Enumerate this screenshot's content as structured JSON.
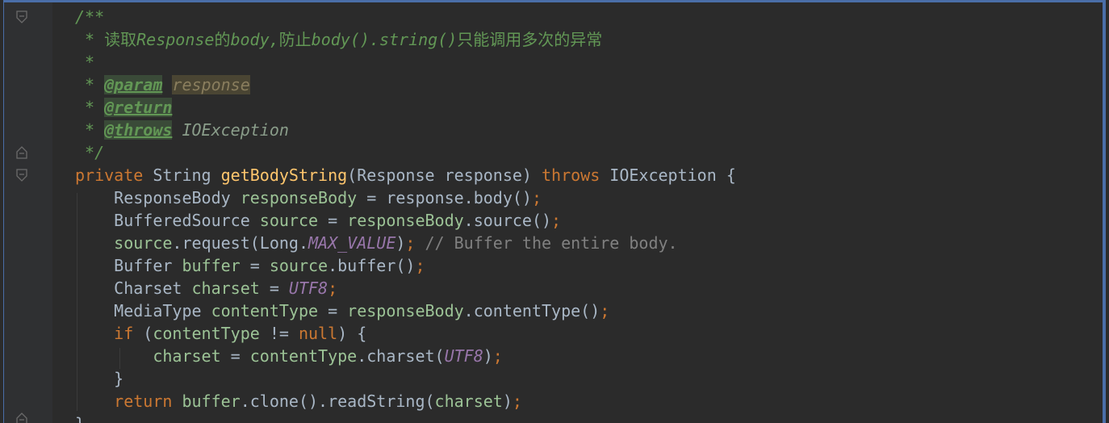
{
  "editor": {
    "lines": [
      {
        "segs": [
          {
            "c": "comment",
            "t": "/**"
          }
        ]
      },
      {
        "segs": [
          {
            "c": "comment",
            "t": " * "
          },
          {
            "c": "comment cn",
            "t": "读取"
          },
          {
            "c": "comment",
            "t": "Response"
          },
          {
            "c": "comment cn",
            "t": "的"
          },
          {
            "c": "comment",
            "t": "body,"
          },
          {
            "c": "comment cn",
            "t": "防止"
          },
          {
            "c": "comment",
            "t": "body().string()"
          },
          {
            "c": "comment cn",
            "t": "只能调用多次的异常"
          }
        ]
      },
      {
        "segs": [
          {
            "c": "comment",
            "t": " *"
          }
        ]
      },
      {
        "segs": [
          {
            "c": "comment",
            "t": " * "
          },
          {
            "c": "doc-tag",
            "t": "@param"
          },
          {
            "c": "comment",
            "t": " "
          },
          {
            "c": "doc-param",
            "t": "response"
          }
        ]
      },
      {
        "segs": [
          {
            "c": "comment",
            "t": " * "
          },
          {
            "c": "doc-tag",
            "t": "@return"
          }
        ]
      },
      {
        "segs": [
          {
            "c": "comment",
            "t": " * "
          },
          {
            "c": "doc-tag",
            "t": "@throws"
          },
          {
            "c": "comment",
            "t": " "
          },
          {
            "c": "doc-exc",
            "t": "IOException"
          }
        ]
      },
      {
        "segs": [
          {
            "c": "comment",
            "t": " */"
          }
        ]
      },
      {
        "segs": [
          {
            "c": "kw",
            "t": "private "
          },
          {
            "c": "cls",
            "t": "String "
          },
          {
            "c": "fn",
            "t": "getBodyString"
          },
          {
            "c": "cls",
            "t": "(Response response) "
          },
          {
            "c": "kw",
            "t": "throws "
          },
          {
            "c": "cls",
            "t": "IOException {"
          }
        ]
      },
      {
        "segs": [
          {
            "c": "cls",
            "t": "    ResponseBody "
          },
          {
            "c": "local",
            "t": "responseBody"
          },
          {
            "c": "cls",
            "t": " = response.body()"
          },
          {
            "c": "kw",
            "t": ";"
          }
        ]
      },
      {
        "segs": [
          {
            "c": "cls",
            "t": "    BufferedSource "
          },
          {
            "c": "local",
            "t": "source"
          },
          {
            "c": "cls",
            "t": " = "
          },
          {
            "c": "local",
            "t": "responseBody"
          },
          {
            "c": "cls",
            "t": ".source()"
          },
          {
            "c": "kw",
            "t": ";"
          }
        ]
      },
      {
        "segs": [
          {
            "c": "local",
            "t": "    source"
          },
          {
            "c": "cls",
            "t": ".request(Long."
          },
          {
            "c": "const",
            "t": "MAX_VALUE"
          },
          {
            "c": "cls",
            "t": ")"
          },
          {
            "c": "kw",
            "t": "; "
          },
          {
            "c": "line-comment",
            "t": "// Buffer the entire body."
          }
        ]
      },
      {
        "segs": [
          {
            "c": "cls",
            "t": "    Buffer "
          },
          {
            "c": "local",
            "t": "buffer"
          },
          {
            "c": "cls",
            "t": " = "
          },
          {
            "c": "local",
            "t": "source"
          },
          {
            "c": "cls",
            "t": ".buffer()"
          },
          {
            "c": "kw",
            "t": ";"
          }
        ]
      },
      {
        "segs": [
          {
            "c": "cls",
            "t": "    Charset "
          },
          {
            "c": "local",
            "t": "charset"
          },
          {
            "c": "cls",
            "t": " = "
          },
          {
            "c": "const",
            "t": "UTF8"
          },
          {
            "c": "kw",
            "t": ";"
          }
        ]
      },
      {
        "segs": [
          {
            "c": "cls",
            "t": "    MediaType "
          },
          {
            "c": "local",
            "t": "contentType"
          },
          {
            "c": "cls",
            "t": " = "
          },
          {
            "c": "local",
            "t": "responseBody"
          },
          {
            "c": "cls",
            "t": ".contentType()"
          },
          {
            "c": "kw",
            "t": ";"
          }
        ]
      },
      {
        "segs": [
          {
            "c": "kw",
            "t": "    if "
          },
          {
            "c": "cls",
            "t": "("
          },
          {
            "c": "local",
            "t": "contentType"
          },
          {
            "c": "cls",
            "t": " != "
          },
          {
            "c": "kw",
            "t": "null"
          },
          {
            "c": "cls",
            "t": ") {"
          }
        ]
      },
      {
        "segs": [
          {
            "c": "local",
            "t": "        charset"
          },
          {
            "c": "cls",
            "t": " = "
          },
          {
            "c": "local",
            "t": "contentType"
          },
          {
            "c": "cls",
            "t": ".charset("
          },
          {
            "c": "const",
            "t": "UTF8"
          },
          {
            "c": "cls",
            "t": ")"
          },
          {
            "c": "kw",
            "t": ";"
          }
        ]
      },
      {
        "segs": [
          {
            "c": "cls",
            "t": "    }"
          }
        ]
      },
      {
        "segs": [
          {
            "c": "kw",
            "t": "    return "
          },
          {
            "c": "local",
            "t": "buffer"
          },
          {
            "c": "cls",
            "t": ".clone().readString("
          },
          {
            "c": "local",
            "t": "charset"
          },
          {
            "c": "cls",
            "t": ")"
          },
          {
            "c": "kw",
            "t": ";"
          }
        ]
      },
      {
        "segs": [
          {
            "c": "cls",
            "t": "}"
          }
        ]
      }
    ],
    "fold_icons": [
      "fold-open-icon",
      "fold-close-icon",
      "fold-open-icon",
      "fold-close-icon"
    ]
  }
}
